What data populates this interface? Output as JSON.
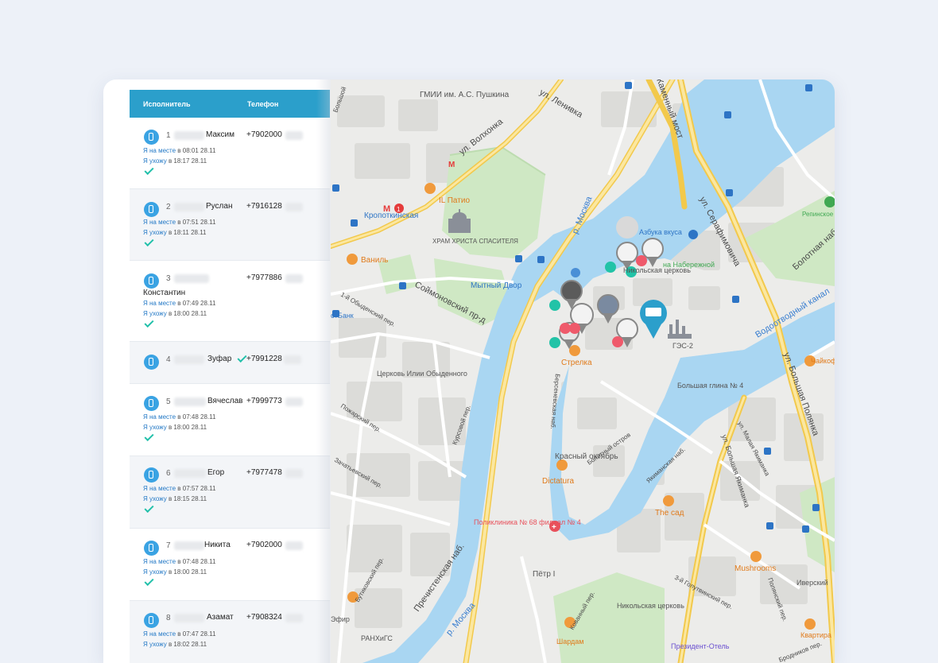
{
  "table": {
    "headers": {
      "executor": "Исполнитель",
      "phone": "Телефон"
    },
    "status_on_site": "Я на месте",
    "status_leaving": "Я ухожу",
    "rows": [
      {
        "num": "1",
        "name": "Максим",
        "phone": "+7902000",
        "arrived": "в 08:01 28.11",
        "left": "в 18:17 28.11"
      },
      {
        "num": "2",
        "name": "Руслан",
        "phone": "+7916128",
        "arrived": "в 07:51 28.11",
        "left": "в 18:11 28.11"
      },
      {
        "num": "3",
        "name": "Константин",
        "phone": "+7977886",
        "arrived": "в 07:49 28.11",
        "left": "в 18:00 28.11"
      },
      {
        "num": "4",
        "name": "Зуфар",
        "phone": "+7991228"
      },
      {
        "num": "5",
        "name": "Вячеслав",
        "phone": "+7999773",
        "arrived": "в 07:48 28.11",
        "left": "в 18:00 28.11"
      },
      {
        "num": "6",
        "name": "Егор",
        "phone": "+7977478",
        "arrived": "в 07:57 28.11",
        "left": "в 18:15 28.11"
      },
      {
        "num": "7",
        "name": "Никита",
        "phone": "+7902000",
        "arrived": "в 07:48 28.11",
        "left": "в 18:00 28.11"
      },
      {
        "num": "8",
        "name": "Азамат",
        "phone": "+7908324",
        "arrived": "в 07:47 28.11",
        "left": "в 18:02 28.11"
      }
    ]
  },
  "map": {
    "streets": {
      "lenivka": "ул. Ленивка",
      "volkhonka": "ул. Волхонка",
      "kamenny_most": "Каменный мост",
      "serafimovicha": "ул. Серафимовича",
      "bolotnaya": "Болотная наб.",
      "vodootvodny": "Водоотводный канал",
      "bolshaya_polyanka": "ул. Большая Полянка",
      "soymonovsky": "Соймоновский пр-д",
      "obydensky": "1-й Обыденский пер.",
      "prechistenskaya": "Пречистенская наб.",
      "bersenevskaya": "Берсеневская наб.",
      "bolotny_ostrov": "Болотный остров",
      "kursovoy": "Курсовой пер.",
      "pozharsky": "Пожарский пер.",
      "zachatyevsky": "Зачатьевский пер.",
      "yakimanskaya": "Якиманская наб.",
      "malaya_yakimanka": "ул. Малая Якиманка",
      "bolshaya_yakimanka": "ул. Большая Якиманка",
      "golutvinsky": "3-й Голутвинский пер.",
      "polyansky": "Полянский пер.",
      "butikovsky": "Бутиковский пер.",
      "kovanny": "Кованный пер.",
      "bolshoy": "Большой",
      "brodnikov": "Бродников пер.",
      "moskva_river_1": "р. Москва",
      "moskva_river_2": "р. Москва"
    },
    "pois": {
      "gmii": "ГМИИ им. А.С. Пушкина",
      "il_patio": "IL Патио",
      "kropotkinskaya": "Кропоткинская",
      "khram": "ХРАМ ХРИСТА СПАСИТЕЛЯ",
      "vanil": "Ваниль",
      "mytny_dvor": "Мытный Двор",
      "strelka": "Стрелка",
      "tserkov_ilii": "Церковь Илии Обыденного",
      "krasny_oktyabr": "Красный октябрь",
      "dictatura": "Dictatura",
      "poliklinika": "Поликлиника № 68 филиал № 4",
      "petr": "Пётр I",
      "ranhigs": "РАНХиГС",
      "efir": "Эфир",
      "azbuka": "Азбука вкуса",
      "nikolskaya_1": "Никольская церковь",
      "na_naberezhnoy": "на Набережной",
      "ges2": "ГЭС-2",
      "bolshaya_glina": "Большая глина № 4",
      "the_sad": "The сад",
      "mushrooms": "Mushrooms",
      "iversky": "Иверский",
      "kvartira": "Квартира",
      "prezident": "Президент-Отель",
      "shardam": "Шардам",
      "nikolskaya_2": "Никольская церковь",
      "repinskoe": "Репинское",
      "chaykof": "Чайкоф",
      "otbank": "отБанк"
    },
    "metro_badge": "1"
  }
}
